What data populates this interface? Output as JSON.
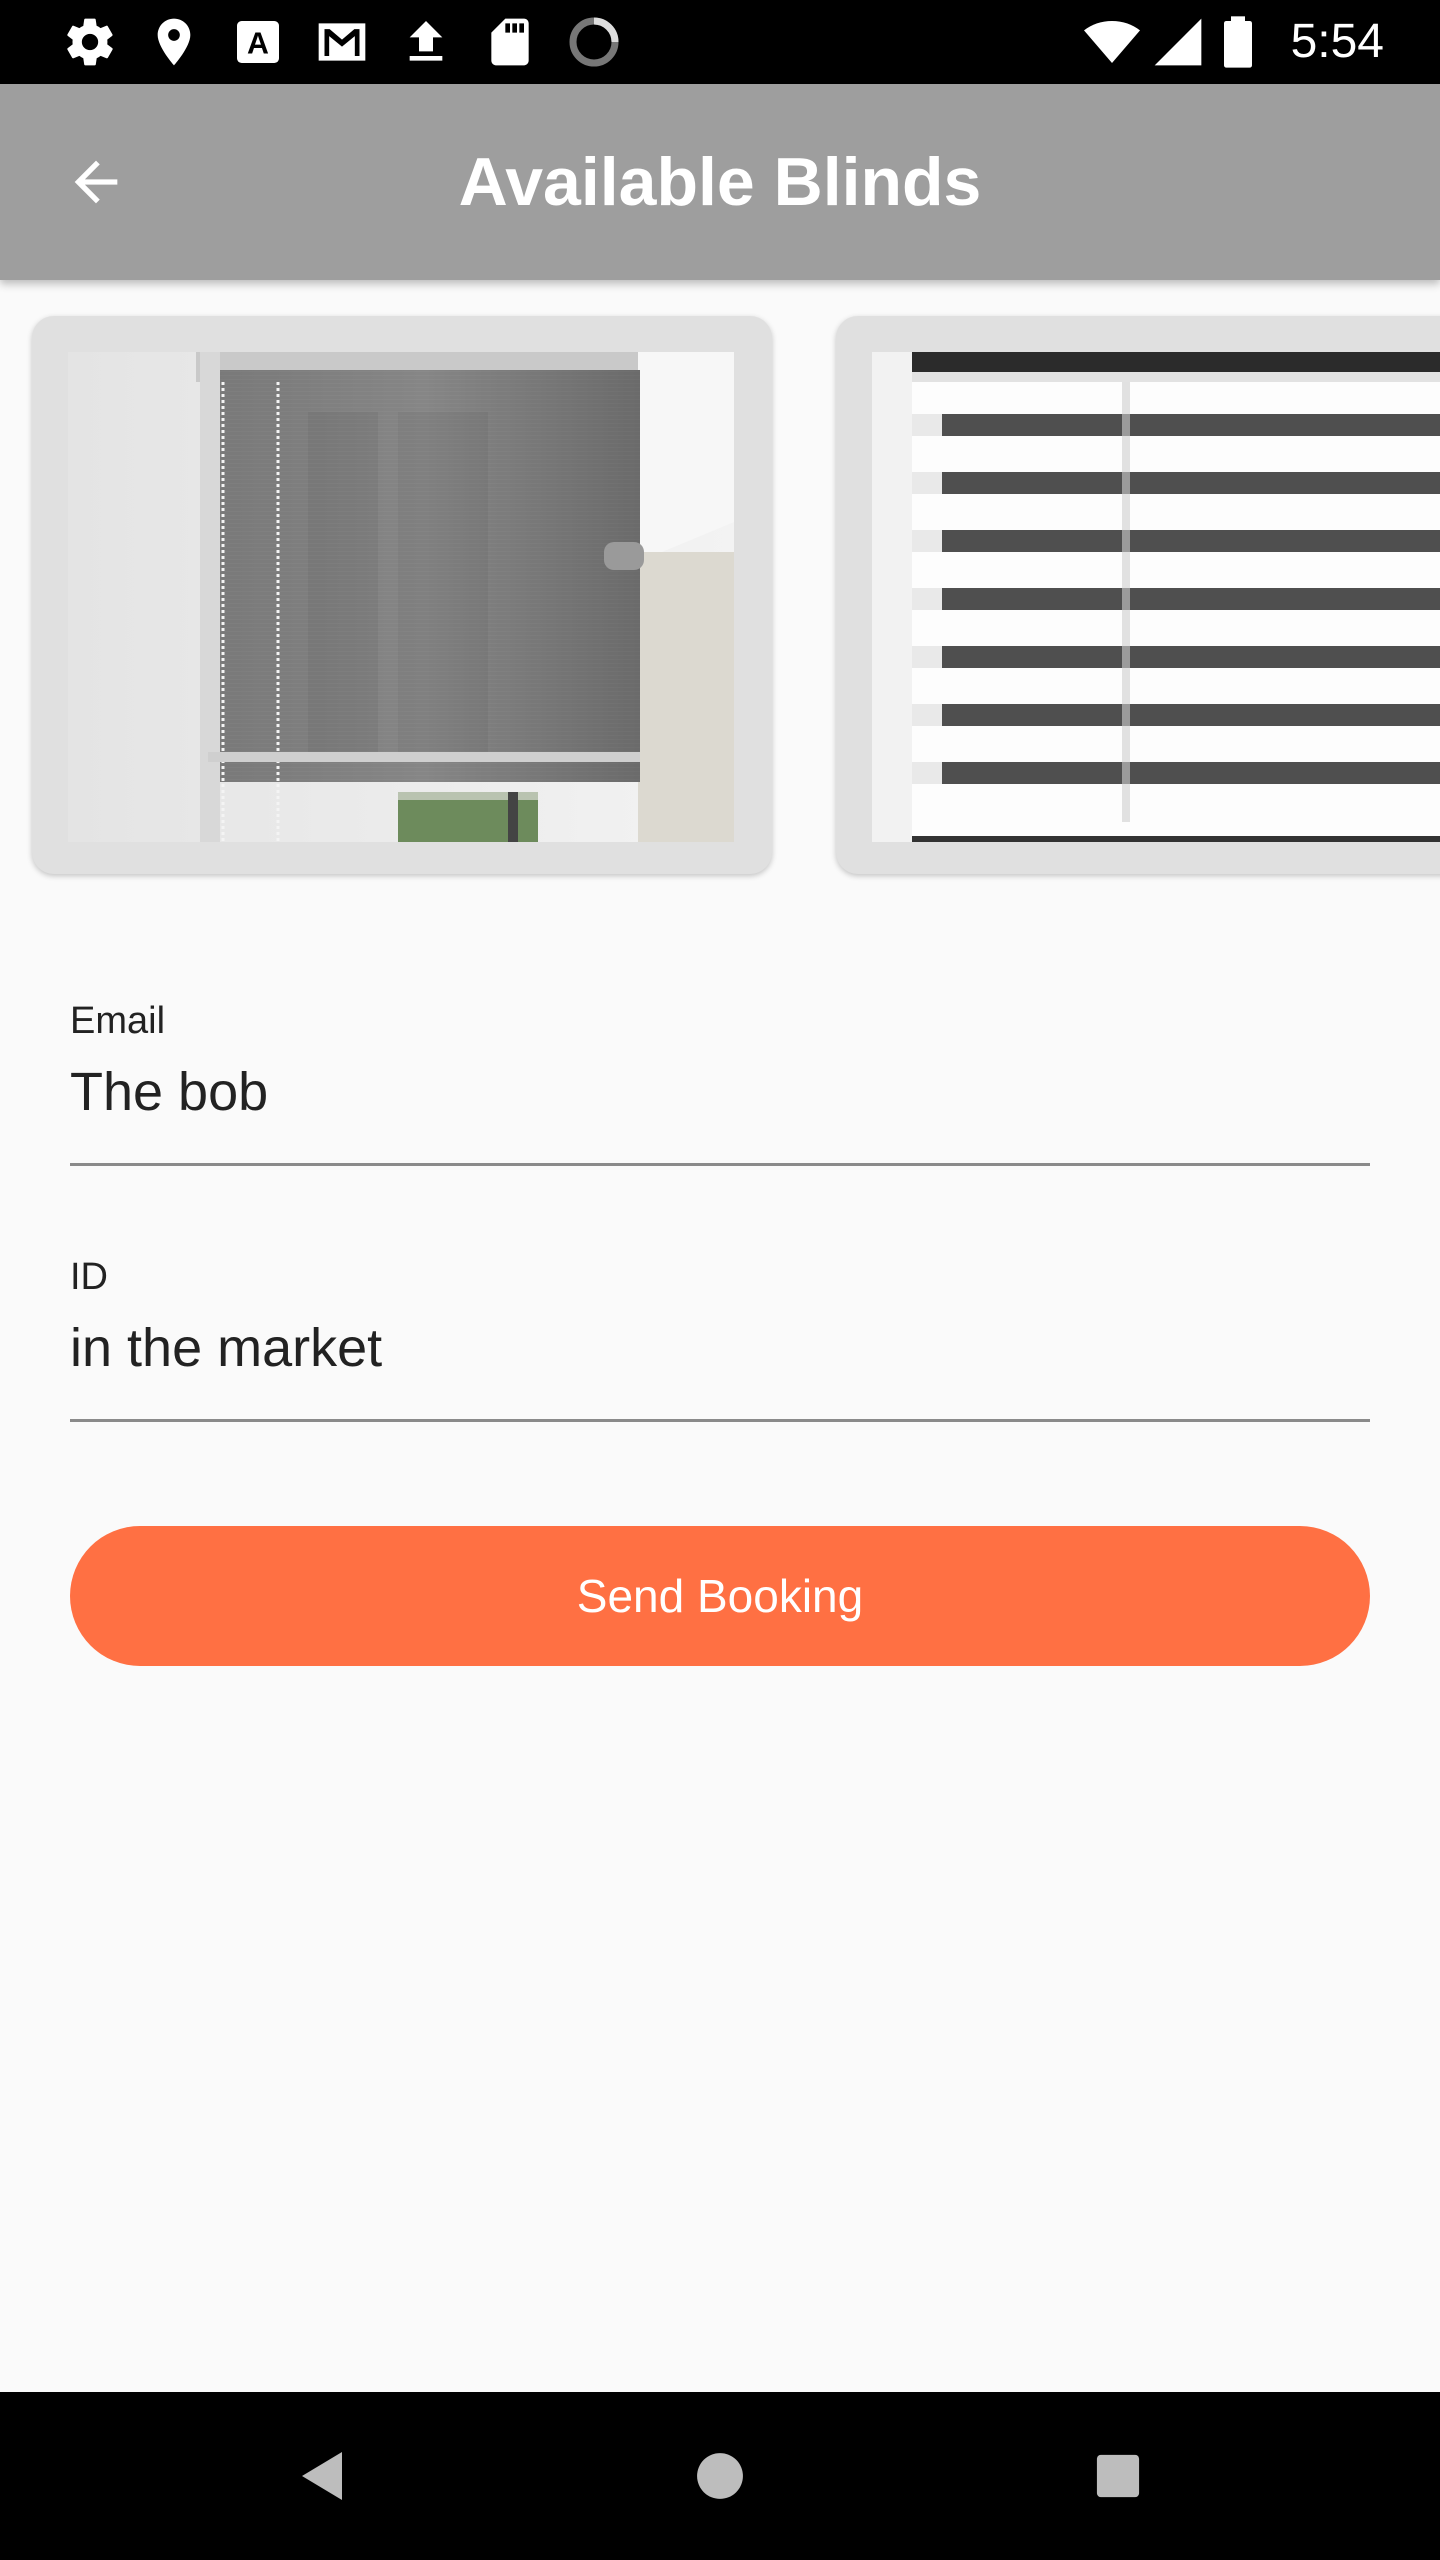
{
  "status_bar": {
    "time": "5:54",
    "icons": [
      "settings-icon",
      "location-icon",
      "a-icon",
      "gmail-icon",
      "upload-icon",
      "sd-card-icon",
      "loading-icon",
      "wifi-icon",
      "signal-icon",
      "battery-icon"
    ]
  },
  "app_bar": {
    "title": "Available Blinds",
    "back_icon": "back-arrow-icon"
  },
  "carousel": {
    "cards": [
      {
        "kind": "roller-blind"
      },
      {
        "kind": "zebra-blind"
      }
    ]
  },
  "form": {
    "email": {
      "label": "Email",
      "value": "The bob"
    },
    "id": {
      "label": "ID",
      "value": "in the market"
    },
    "submit_label": "Send Booking"
  },
  "colors": {
    "app_bar": "#9e9e9e",
    "accent": "#ff7043",
    "background": "#fafafa"
  },
  "nav_bar": {
    "icons": [
      "back-triangle-icon",
      "home-circle-icon",
      "recents-square-icon"
    ]
  }
}
